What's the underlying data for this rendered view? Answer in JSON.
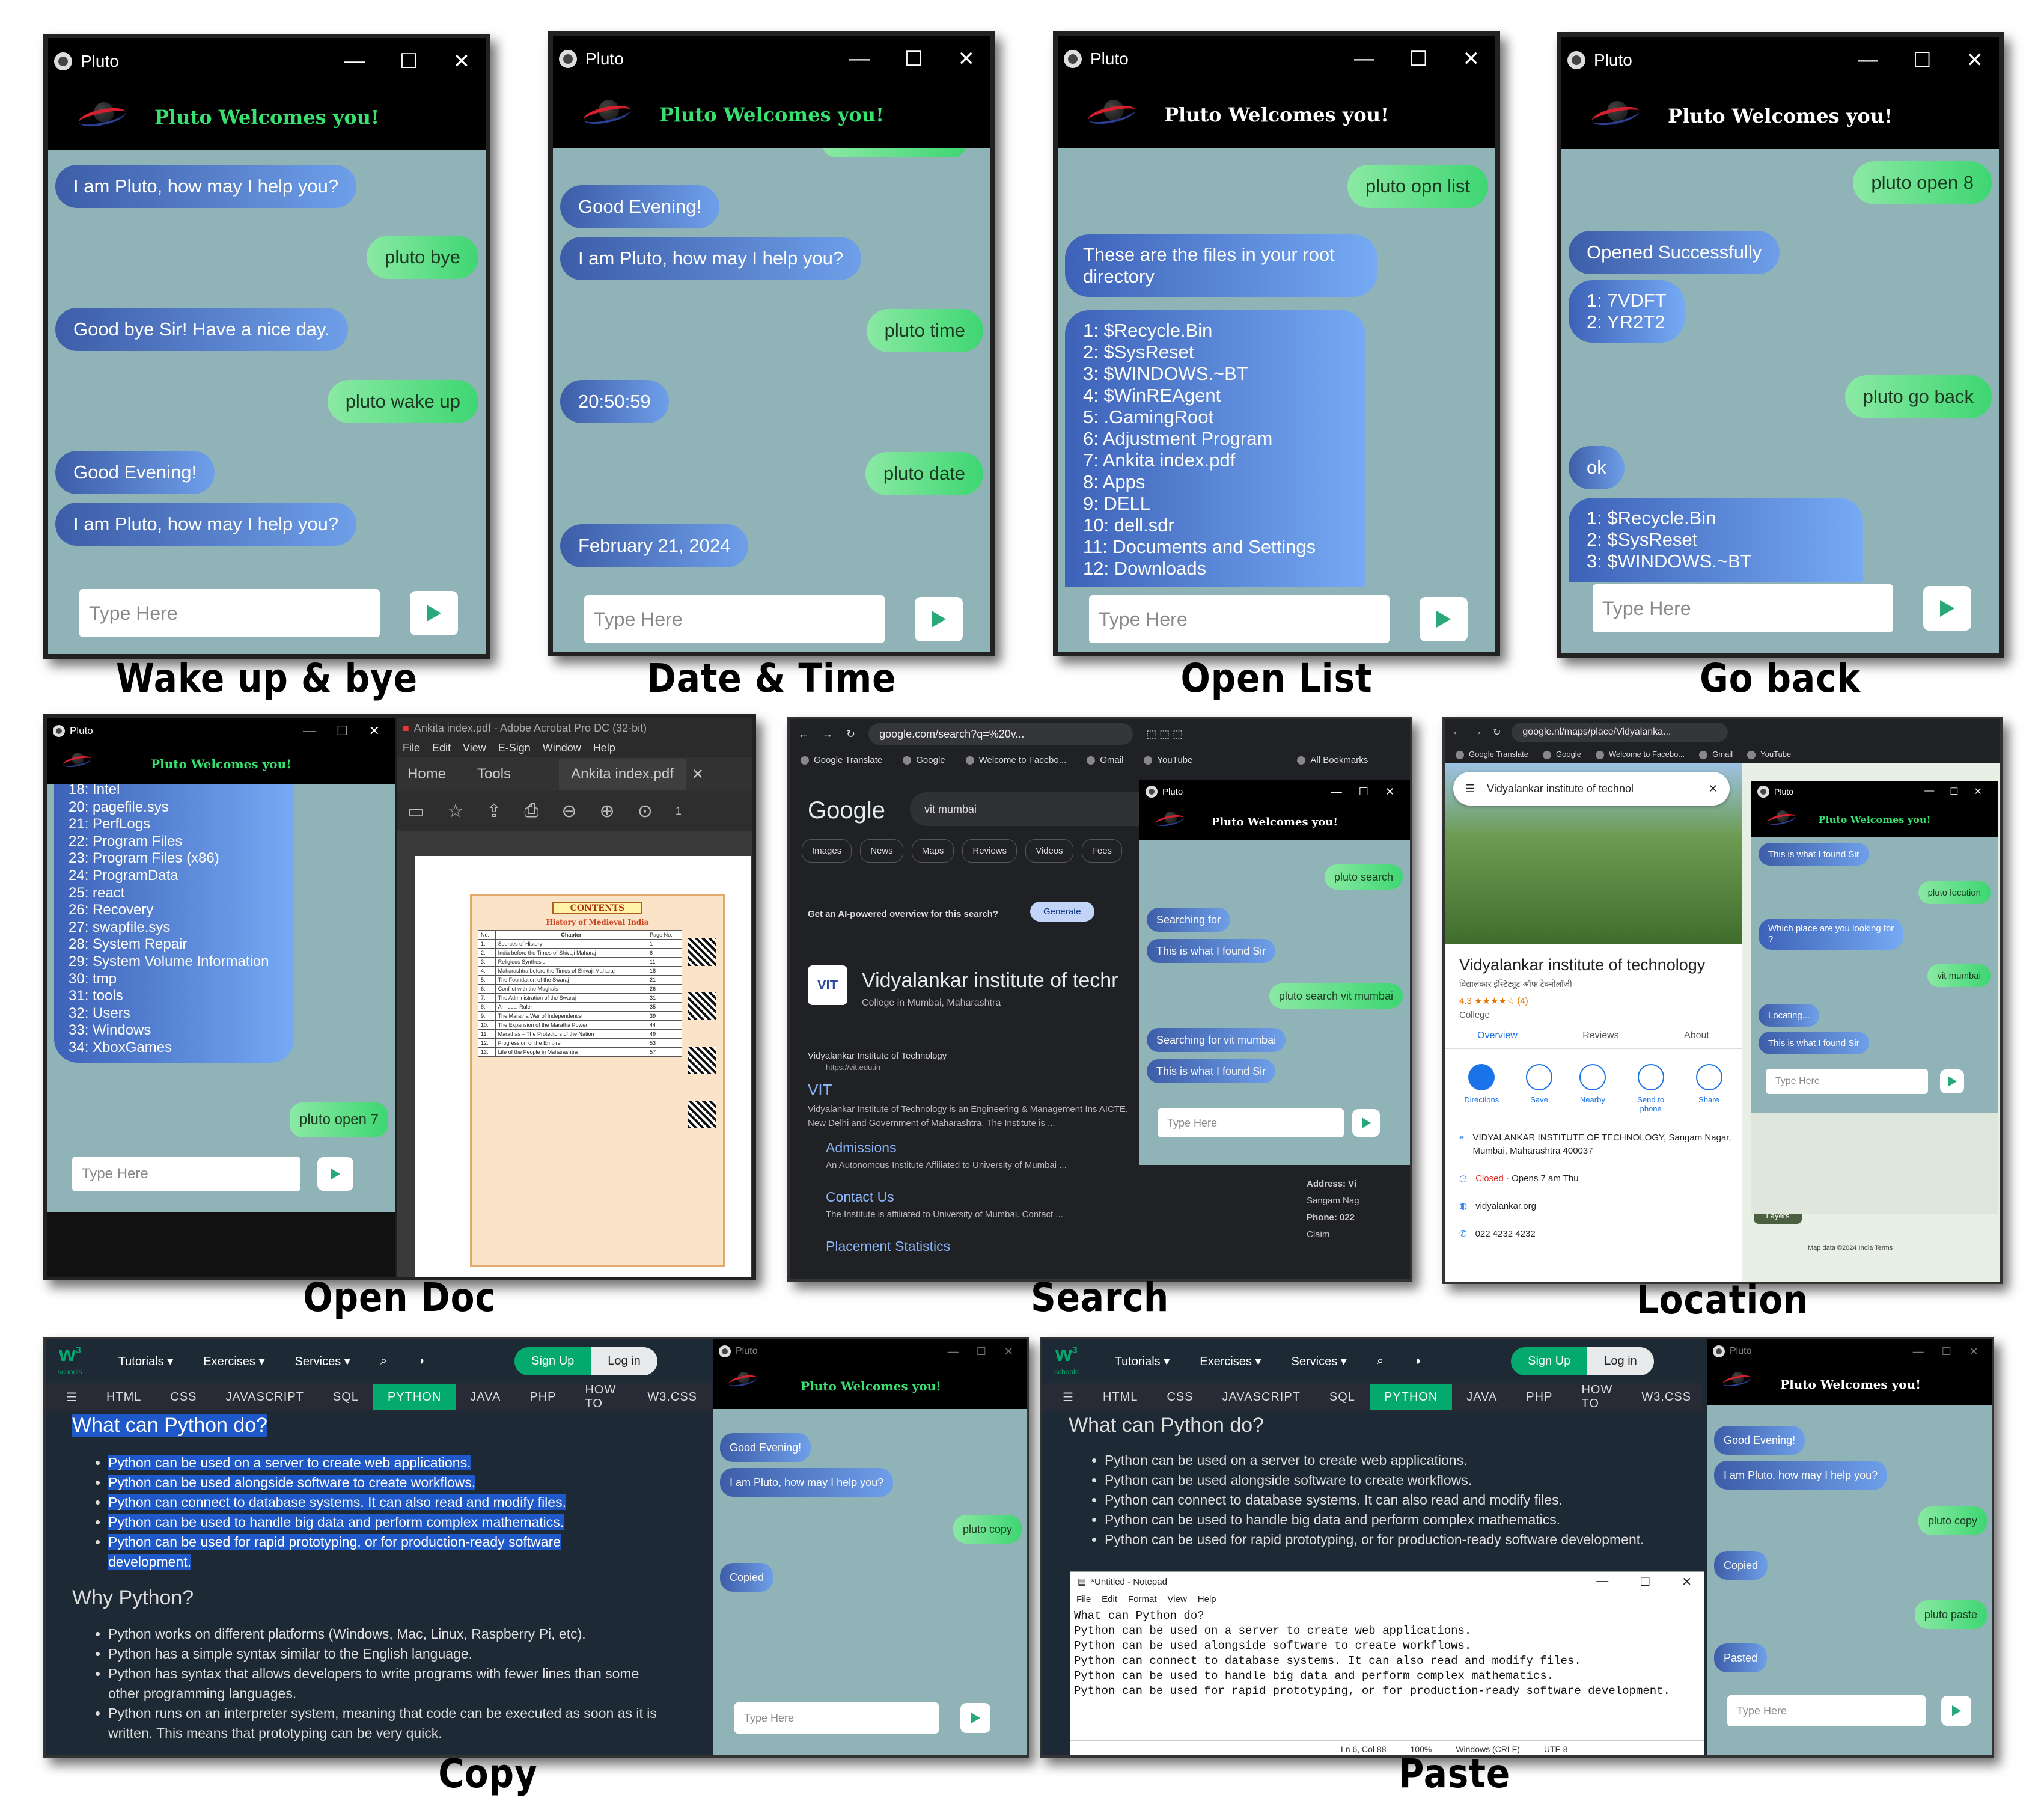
{
  "pluto": {
    "title": "Pluto",
    "welcome": "Pluto Welcomes you!",
    "input_placeholder": "Type Here"
  },
  "captions": {
    "wake": "Wake up & bye",
    "datetime": "Date & Time",
    "openlist": "Open List",
    "goback": "Go back",
    "opendoc": "Open Doc",
    "search": "Search",
    "location": "Location",
    "copy": "Copy",
    "paste": "Paste"
  },
  "wake_chat": [
    {
      "side": "bot",
      "text": "I am Pluto, how may I help you?"
    },
    {
      "side": "user",
      "text": "pluto bye"
    },
    {
      "side": "bot",
      "text": "Good bye Sir! Have a nice day."
    },
    {
      "side": "user",
      "text": "pluto wake up"
    },
    {
      "side": "bot",
      "text": "Good Evening!"
    },
    {
      "side": "bot",
      "text": "I am Pluto, how may I help you?"
    }
  ],
  "datetime_chat": [
    {
      "side": "bot",
      "text": "Good Evening!"
    },
    {
      "side": "bot",
      "text": "I am Pluto, how may I help you?"
    },
    {
      "side": "user",
      "text": "pluto time"
    },
    {
      "side": "bot",
      "text": "20:50:59"
    },
    {
      "side": "user",
      "text": "pluto date"
    },
    {
      "side": "bot",
      "text": "February 21, 2024"
    }
  ],
  "openlist_chat": {
    "user": "pluto opn list",
    "reply": "These are the files in your root\ndirectory",
    "files": "1: $Recycle.Bin\n2: $SysReset\n3: $WINDOWS.~BT\n4: $WinREAgent\n5: .GamingRoot\n6: Adjustment Program\n7: Ankita index.pdf\n8: Apps\n9: DELL\n10: dell.sdr\n11: Documents and Settings\n12: Downloads"
  },
  "goback_chat": {
    "user1": "pluto open 8",
    "reply1": "Opened Successfully",
    "list1": "1: 7VDFT\n2: YR2T2",
    "user2": "pluto go back",
    "reply2": "ok",
    "list2": "1: $Recycle.Bin\n2: $SysReset\n3: $WINDOWS.~BT"
  },
  "opendoc": {
    "files": "18: Intel\n20: pagefile.sys\n21: PerfLogs\n22: Program Files\n23: Program Files (x86)\n24: ProgramData\n25: react\n26: Recovery\n27: swapfile.sys\n28: System Repair\n29: System Volume Information\n30: tmp\n31: tools\n32: Users\n33: Windows\n34: XboxGames",
    "user": "pluto open 7",
    "acrobat_title": "Ankita index.pdf - Adobe Acrobat Pro DC (32-bit)",
    "acrobat_menu": [
      "File",
      "Edit",
      "View",
      "E-Sign",
      "Window",
      "Help"
    ],
    "acrobat_tabs": {
      "home": "Home",
      "tools": "Tools",
      "doc": "Ankita index.pdf"
    },
    "page_num": "1",
    "pdf_heading": "CONTENTS",
    "pdf_sub": "History of Medieval India",
    "pdf_cols": [
      "No.",
      "Chapter",
      "Page No."
    ],
    "pdf_rows": [
      [
        "1.",
        "Sources of History",
        "1"
      ],
      [
        "2.",
        "India before the Times of Shivaji Maharaj",
        "6"
      ],
      [
        "3.",
        "Religious Synthesis",
        "11"
      ],
      [
        "4.",
        "Maharashtra before the Times of Shivaji Maharaj",
        "18"
      ],
      [
        "5.",
        "The Foundation of the Swaraj",
        "21"
      ],
      [
        "6.",
        "Conflict with the Mughals",
        "26"
      ],
      [
        "7.",
        "The Administration of the Swaraj",
        "31"
      ],
      [
        "8.",
        "An Ideal Ruler",
        "35"
      ],
      [
        "9.",
        "The Maratha War of Independence",
        "39"
      ],
      [
        "10.",
        "The Expansion of the Maratha Power",
        "44"
      ],
      [
        "11.",
        "Marathas – The Protectors of the Nation",
        "49"
      ],
      [
        "12.",
        "Progression of the Empire",
        "53"
      ],
      [
        "13.",
        "Life of the People in Maharashtra",
        "57"
      ]
    ]
  },
  "search": {
    "url": "google.com/search?q=%20v...",
    "bookmarks": [
      "Google Translate",
      "Google",
      "Welcome to Facebo...",
      "Gmail",
      "YouTube"
    ],
    "all_bookmarks": "All Bookmarks",
    "google": "Google",
    "query": "vit mumbai",
    "filters": [
      "Images",
      "News",
      "Maps",
      "Reviews",
      "Videos",
      "Fees"
    ],
    "ai_text": "Get an AI-powered overview for this search?",
    "generate": "Generate",
    "kp_title": "Vidyalankar institute of techr",
    "kp_sub": "College in Mumbai, Maharashtra",
    "site_name": "Vidyalankar Institute of Technology",
    "site_url": "https://vit.edu.in",
    "result_title": "VIT",
    "result_snippet": "Vidyalankar Institute of Technology is an Engineering & Management Ins AICTE, New Delhi and Government of Maharashtra. The Institute is ...",
    "links": [
      {
        "t": "Admissions",
        "d": "An Autonomous Institute Affiliated to University of Mumbai ..."
      },
      {
        "t": "Contact Us",
        "d": "The Institute is affiliated to University of Mumbai. Contact ..."
      },
      {
        "t": "Placement Statistics",
        "d": ""
      }
    ],
    "address_label": "Address: Vi",
    "address_val": "Sangam Nag",
    "phone_label": "Phone: 022",
    "claim": "Claim",
    "chat": [
      {
        "side": "user",
        "text": "pluto search"
      },
      {
        "side": "bot",
        "text": "Searching for"
      },
      {
        "side": "bot",
        "text": "This is what I found Sir"
      },
      {
        "side": "user",
        "text": "pluto search vit mumbai"
      },
      {
        "side": "bot",
        "text": "Searching for vit mumbai"
      },
      {
        "side": "bot",
        "text": "This is what I found Sir"
      }
    ]
  },
  "location": {
    "url": "google.nl/maps/place/Vidyalanka...",
    "search_text": "Vidyalankar institute of technol",
    "place": "Vidyalankar institute of technology",
    "place_local": "विद्यालंकार इंस्टिट्यूट ऑफ टेक्नोलॉजी",
    "rating": "4.3 ★★★★☆ (4)",
    "category": "College",
    "tabs": [
      "Overview",
      "Reviews",
      "About"
    ],
    "actions": [
      "Directions",
      "Save",
      "Nearby",
      "Send to phone",
      "Share"
    ],
    "address": "VIDYALANKAR INSTITUTE OF TECHNOLOGY, Sangam Nagar, Mumbai, Maharashtra 400037",
    "closed": "Closed",
    "hours": " · Opens 7 am Thu",
    "website": "vidyalankar.org",
    "phone": "022 4232 4232",
    "layers": "Layers",
    "map_footer": "Map data ©2024   India   Terms",
    "chat": [
      {
        "side": "bot",
        "text": "This is what I found Sir"
      },
      {
        "side": "user",
        "text": "pluto location"
      },
      {
        "side": "bot",
        "text": "Which place are you looking for\n?"
      },
      {
        "side": "user",
        "text": "vit mumbai"
      },
      {
        "side": "bot",
        "text": "Locating..."
      },
      {
        "side": "bot",
        "text": "This is what I found Sir"
      }
    ]
  },
  "w3": {
    "top": [
      "Tutorials ▾",
      "Exercises ▾",
      "Services ▾"
    ],
    "signup": "Sign Up",
    "login": "Log in",
    "sub": [
      "HTML",
      "CSS",
      "JAVASCRIPT",
      "SQL",
      "PYTHON",
      "JAVA",
      "PHP",
      "HOW TO",
      "W3.CSS"
    ],
    "h1": "What can Python do?",
    "items": [
      "Python can be used on a server to create web applications.",
      "Python can be used alongside software to create workflows.",
      "Python can connect to database systems. It can also read and modify files.",
      "Python can be used to handle big data and perform complex mathematics.",
      "Python can be used for rapid prototyping, or for production-ready software development."
    ],
    "h2": "Why Python?",
    "why": [
      "Python works on different platforms (Windows, Mac, Linux, Raspberry Pi, etc).",
      "Python has a simple syntax similar to the English language.",
      "Python has syntax that allows developers to write programs with fewer lines than some other programming languages.",
      "Python runs on an interpreter system, meaning that code can be executed as soon as it is written. This means that prototyping can be very quick."
    ],
    "logo_sub": "schools"
  },
  "copy_chat": [
    {
      "side": "bot",
      "text": "Good Evening!"
    },
    {
      "side": "bot",
      "text": "I am Pluto, how may I help you?"
    },
    {
      "side": "user",
      "text": "pluto copy"
    },
    {
      "side": "bot",
      "text": "Copied"
    }
  ],
  "paste": {
    "np_title": "*Untitled - Notepad",
    "np_menu": [
      "File",
      "Edit",
      "Format",
      "View",
      "Help"
    ],
    "np_text": "What can Python do?\nPython can be used on a server to create web applications.\nPython can be used alongside software to create workflows.\nPython can connect to database systems. It can also read and modify files.\nPython can be used to handle big data and perform complex mathematics.\nPython can be used for rapid prototyping, or for production-ready software development.",
    "status": [
      "Ln 6, Col 88",
      "100%",
      "Windows (CRLF)",
      "UTF-8"
    ],
    "chat": [
      {
        "side": "bot",
        "text": "Good Evening!"
      },
      {
        "side": "bot",
        "text": "I am Pluto, how may I help you?"
      },
      {
        "side": "user",
        "text": "pluto copy"
      },
      {
        "side": "bot",
        "text": "Copied"
      },
      {
        "side": "user",
        "text": "pluto paste"
      },
      {
        "side": "bot",
        "text": "Pasted"
      }
    ]
  }
}
